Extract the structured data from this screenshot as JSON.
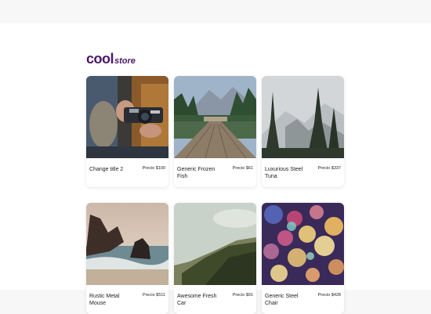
{
  "brand": {
    "part1": "cool",
    "part2": "store"
  },
  "products": [
    {
      "name": "Change title 2",
      "price": "Precio $100"
    },
    {
      "name": "Generic Frozen Fish",
      "price": "Precio $61"
    },
    {
      "name": "Luxurious Steel Tuna",
      "price": "Precio $337"
    },
    {
      "name": "Rustic Metal Mouse",
      "price": "Precio $511"
    },
    {
      "name": "Awesome Fresh Car",
      "price": "Precio $91"
    },
    {
      "name": "Generic Steel Chair",
      "price": "Precio $428"
    }
  ]
}
